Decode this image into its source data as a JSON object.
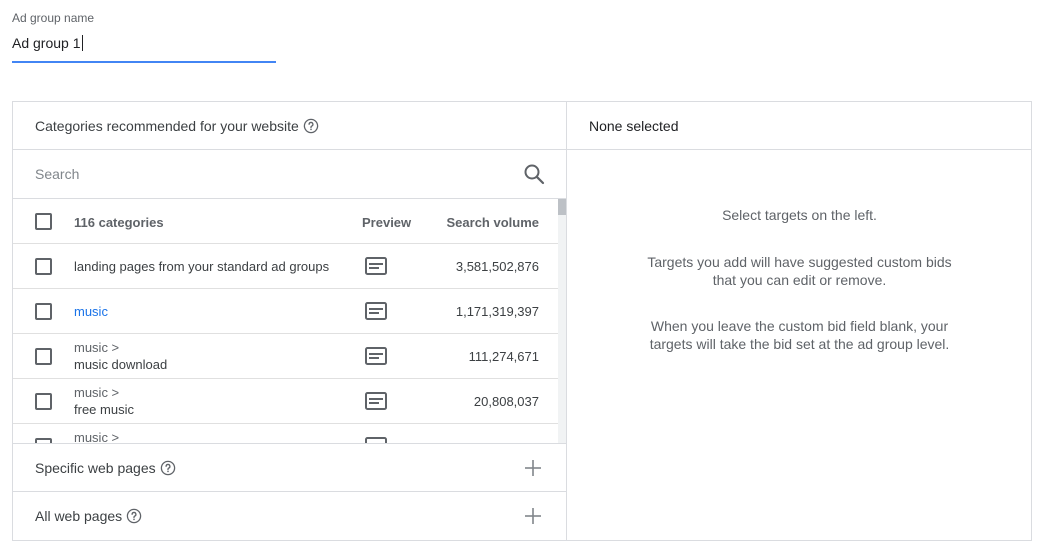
{
  "ad_group": {
    "label": "Ad group name",
    "value": "Ad group 1"
  },
  "left_panel": {
    "title": "Categories recommended for your website",
    "search_placeholder": "Search",
    "table": {
      "headers": {
        "count": "116 categories",
        "preview": "Preview",
        "volume": "Search volume"
      },
      "rows": [
        {
          "name": "landing pages from your standard ad groups",
          "parent": "",
          "volume": "3,581,502,876",
          "link": false
        },
        {
          "name": "music",
          "parent": "",
          "volume": "1,171,319,397",
          "link": true
        },
        {
          "name": "music download",
          "parent": "music >",
          "volume": "111,274,671",
          "link": false
        },
        {
          "name": "free music",
          "parent": "music >",
          "volume": "20,808,037",
          "link": false
        },
        {
          "name": "",
          "parent": "music >",
          "volume": "",
          "link": false
        }
      ]
    },
    "sections": [
      {
        "label": "Specific web pages"
      },
      {
        "label": "All web pages"
      }
    ]
  },
  "right_panel": {
    "title": "None selected",
    "hints": [
      "Select targets on the left.",
      "Targets you add will have suggested custom bids that you can edit or remove.",
      "When you leave the custom bid field blank, your targets will take the bid set at the ad group level."
    ]
  },
  "colors": {
    "accent": "#4285f4",
    "link": "#1a73e8",
    "border": "#dadce0"
  },
  "icons": {
    "help": "help-circle-icon",
    "search": "search-icon",
    "preview": "preview-icon",
    "add": "plus-icon",
    "checkbox": "checkbox-unchecked-icon"
  }
}
